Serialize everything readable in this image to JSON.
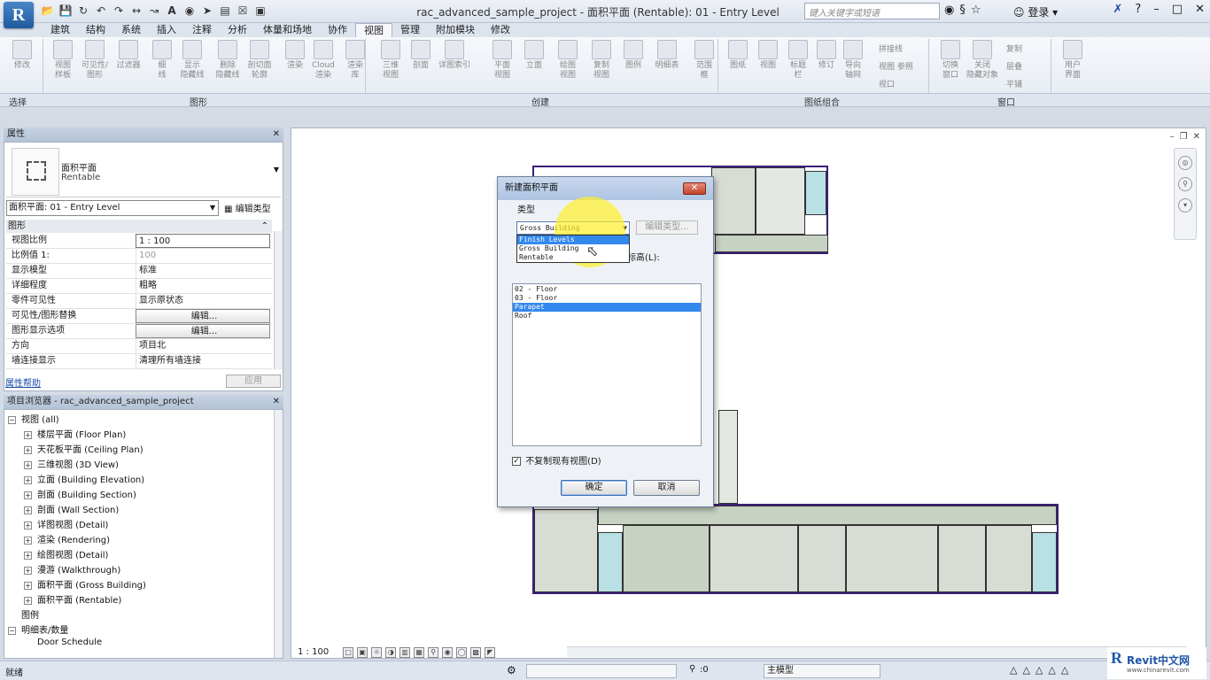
{
  "app": {
    "logo": "R",
    "title": "rac_advanced_sample_project - 面积平面 (Rentable): 01 - Entry Level",
    "search_placeholder": "键入关键字或短语",
    "login": "登录"
  },
  "ribbon": {
    "tabs": [
      "建筑",
      "结构",
      "系统",
      "插入",
      "注释",
      "分析",
      "体量和场地",
      "协作",
      "视图",
      "管理",
      "附加模块",
      "修改"
    ],
    "active_tab": "视图",
    "buttons": [
      {
        "label": "修改",
        "sub": ""
      },
      {
        "label": "视图",
        "sub": "样板"
      },
      {
        "label": "可见性/",
        "sub": "图形"
      },
      {
        "label": "过滤器",
        "sub": ""
      },
      {
        "label": "细",
        "sub": "线"
      },
      {
        "label": "显示",
        "sub": "隐藏线"
      },
      {
        "label": "删除",
        "sub": "隐藏线"
      },
      {
        "label": "剖切面",
        "sub": "轮廓"
      },
      {
        "label": "渲染",
        "sub": ""
      },
      {
        "label": "Cloud",
        "sub": "渲染"
      },
      {
        "label": "渲染",
        "sub": "库"
      },
      {
        "label": "三维",
        "sub": "视图"
      },
      {
        "label": "剖面",
        "sub": ""
      },
      {
        "label": "详图索引",
        "sub": ""
      },
      {
        "label": "平面",
        "sub": "视图"
      },
      {
        "label": "立面",
        "sub": ""
      },
      {
        "label": "绘图",
        "sub": "视图"
      },
      {
        "label": "复制",
        "sub": "视图"
      },
      {
        "label": "图例",
        "sub": ""
      },
      {
        "label": "明细表",
        "sub": ""
      },
      {
        "label": "范围",
        "sub": "框"
      },
      {
        "label": "图纸",
        "sub": ""
      },
      {
        "label": "视图",
        "sub": ""
      },
      {
        "label": "标题",
        "sub": "栏"
      },
      {
        "label": "修订",
        "sub": ""
      },
      {
        "label": "导向",
        "sub": "轴网"
      },
      {
        "label": "切换",
        "sub": "窗口"
      },
      {
        "label": "关闭",
        "sub": "隐藏对象"
      },
      {
        "label": "用户",
        "sub": "界面"
      }
    ],
    "small_items": [
      "拼接线",
      "视图 参照",
      "视口",
      "复制",
      "层叠",
      "平铺"
    ],
    "panels": [
      "选择",
      "图形",
      "创建",
      "图纸组合",
      "窗口"
    ]
  },
  "properties": {
    "header": "属性",
    "type_name": "面积平面",
    "type_sub": "Rentable",
    "instance_selector": "面积平面: 01 - Entry Level",
    "edit_type": "编辑类型",
    "group": "图形",
    "rows": [
      {
        "k": "视图比例",
        "v": "1 : 100",
        "style": "box"
      },
      {
        "k": "比例值 1:",
        "v": "100",
        "style": "gray"
      },
      {
        "k": "显示模型",
        "v": "标准",
        "style": ""
      },
      {
        "k": "详细程度",
        "v": "粗略",
        "style": ""
      },
      {
        "k": "零件可见性",
        "v": "显示原状态",
        "style": ""
      },
      {
        "k": "可见性/图形替换",
        "v": "编辑...",
        "style": "btn"
      },
      {
        "k": "图形显示选项",
        "v": "编辑...",
        "style": "btn"
      },
      {
        "k": "方向",
        "v": "项目北",
        "style": ""
      },
      {
        "k": "墙连接显示",
        "v": "清理所有墙连接",
        "style": ""
      }
    ],
    "help": "属性帮助",
    "apply": "应用"
  },
  "browser": {
    "header": "项目浏览器 - rac_advanced_sample_project",
    "items": [
      {
        "label": "视图 (all)",
        "level": 0,
        "toggle": "−"
      },
      {
        "label": "楼层平面 (Floor Plan)",
        "level": 1,
        "toggle": "+"
      },
      {
        "label": "天花板平面 (Ceiling Plan)",
        "level": 1,
        "toggle": "+"
      },
      {
        "label": "三维视图 (3D View)",
        "level": 1,
        "toggle": "+"
      },
      {
        "label": "立面 (Building Elevation)",
        "level": 1,
        "toggle": "+"
      },
      {
        "label": "剖面 (Building Section)",
        "level": 1,
        "toggle": "+"
      },
      {
        "label": "剖面 (Wall Section)",
        "level": 1,
        "toggle": "+"
      },
      {
        "label": "详图视图 (Detail)",
        "level": 1,
        "toggle": "+"
      },
      {
        "label": "渲染 (Rendering)",
        "level": 1,
        "toggle": "+"
      },
      {
        "label": "绘图视图 (Detail)",
        "level": 1,
        "toggle": "+"
      },
      {
        "label": "漫游 (Walkthrough)",
        "level": 1,
        "toggle": "+"
      },
      {
        "label": "面积平面 (Gross Building)",
        "level": 1,
        "toggle": "+"
      },
      {
        "label": "面积平面 (Rentable)",
        "level": 1,
        "toggle": "+"
      },
      {
        "label": "图例",
        "level": 0,
        "toggle": ""
      },
      {
        "label": "明细表/数量",
        "level": 0,
        "toggle": "−"
      },
      {
        "label": "Door Schedule",
        "level": 1,
        "toggle": ""
      }
    ]
  },
  "dialog": {
    "title": "新建面积平面",
    "group_label": "类型",
    "combo_value": "Gross Building",
    "edit_type": "编辑类型...",
    "dropdown_options": [
      "Finish Levels",
      "Gross Building",
      "Rentable"
    ],
    "dropdown_highlight": "Finish Levels",
    "scale_label": "标高(L):",
    "levels": [
      "02 - Floor",
      "03 - Floor",
      "Parapet",
      "Roof"
    ],
    "selected_level": "Parapet",
    "checkbox_label": "不复制现有视图(D)",
    "checkbox_checked": true,
    "ok": "确定",
    "cancel": "取消"
  },
  "viewbar": {
    "scale": "1 : 100"
  },
  "status": {
    "text": "就绪",
    "coord": ":0",
    "model": "主模型"
  },
  "watermark": {
    "logo": "R",
    "brand": "Revit中文网",
    "url": "www.chinarevit.com"
  },
  "colors": {
    "accent": "#3388ee",
    "wall": "#3b1f78",
    "room_fill": "#d7ddd5"
  }
}
